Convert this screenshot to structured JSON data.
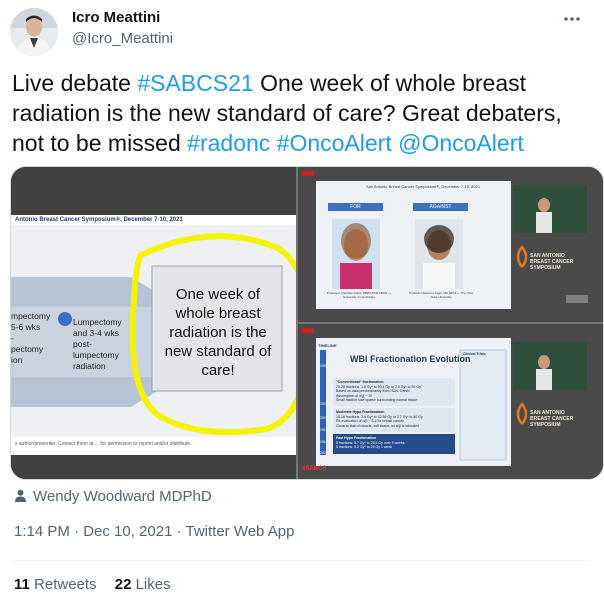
{
  "author": {
    "display_name": "Icro Meattini",
    "handle": "@Icro_Meattini"
  },
  "tweet": {
    "part1": "Live debate ",
    "hashtag1": "#SABCS21",
    "part2": " One week of whole breast radiation is the new standard of care? Great debaters, not to be missed ",
    "hashtag2": "#radonc",
    "space1": " ",
    "hashtag3": "#OncoAlert",
    "space2": " ",
    "mention1": "@OncoAlert"
  },
  "media": {
    "left": {
      "header": "Antonio Breast Cancer Symposium®, December 7-10, 2021",
      "box_text": "One week of whole breast radiation is the new standard of care!",
      "arrow_text1": "Lumpectomy and 3-4 wks post-lumpectomy radiation",
      "arrow_text2_lines": [
        "mpectomy",
        "5-6 wks",
        "-",
        "pectomy",
        "ion"
      ],
      "footer": "s author/presenter. Contact them at ... for permission to reprint and/or distribute."
    },
    "right_top": {
      "header": "San Antonio Breast Cancer Symposium®, December 7-10, 2021",
      "label_for": "FOR",
      "label_against": "AGAINST",
      "person1_caption": "Professor Charlotte Coles, MBBS PhD FRCR — University of Cambridge",
      "person2_caption": "Professor Reshma Jagsi, MD DPhil — The Ohio State University",
      "brand": "SAN ANTONIO BREAST CANCER SYMPOSIUM"
    },
    "right_bottom": {
      "tag": "#SABCS",
      "title": "WBI Fractionation Evolution",
      "timeline_label": "TIMELINE",
      "years": [
        "1990",
        "2000",
        "2006",
        "2010",
        "2015",
        "2020"
      ],
      "section1_title": "\"Conventional\" fractionation",
      "section1_bullets": [
        "25-28 fractions: 1.8 Gy* to 50.4 Gy or 2.0 Gy* to 50 Gy",
        "Based on data predominantly from H&N, Cervix",
        "Assumption of α/β ~ 10",
        "Small fraction size sparse surrounding normal tissue"
      ],
      "section2_title": "Moderate Hypo Fractionation",
      "section2_bullets": [
        "15-16 fractions: 2.6 Gy* to 42.56 Gy or 2.7 Gy* to 40 Gy",
        "Re-evaluation of α/β ~ 3-4 for breast cancer",
        "Close to that of muscle, soft tissue, so α/β is tolerated"
      ],
      "section3_title": "Fast Hypo Fractionation",
      "section3_bullets": [
        "5 fractions: 5.7 Gy* to 28.5 Gy over 5 weeks",
        "5 fractions: 5.2 Gy* to 26 Gy 1 week"
      ],
      "clinical_trials_title": "Clinical Trials",
      "brand": "SAN ANTONIO BREAST CANCER SYMPOSIUM"
    }
  },
  "audience": "Wendy Woodward MDPhD",
  "timestamp": "1:14 PM · Dec 10, 2021 · Twitter Web App",
  "stats": {
    "retweets_count": "11",
    "retweets_label": "Retweets",
    "likes_count": "22",
    "likes_label": "Likes"
  }
}
